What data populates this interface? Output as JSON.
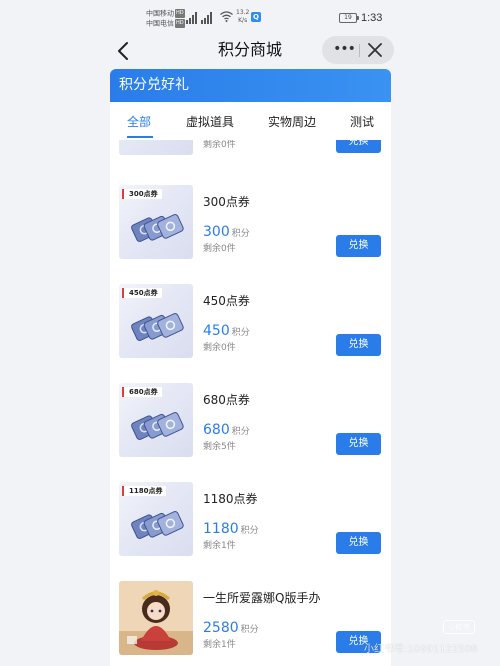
{
  "status_bar": {
    "carrier1": "中国移动",
    "carrier2": "中国电信",
    "hd": "HD",
    "net_speed_value": "13.2",
    "net_speed_unit": "K/s",
    "battery": "19",
    "time": "1:33"
  },
  "nav": {
    "title": "积分商城",
    "more_glyph": "•••"
  },
  "banner": {
    "title": "积分兑好礼"
  },
  "tabs": [
    {
      "label": "全部",
      "active": true
    },
    {
      "label": "虚拟道具",
      "active": false
    },
    {
      "label": "实物周边",
      "active": false
    },
    {
      "label": "测试",
      "active": false
    }
  ],
  "items": [
    {
      "tag": "",
      "name": "",
      "price": "",
      "unit": "",
      "stock": "剩余0件",
      "button": "兑换"
    },
    {
      "tag": "300点券",
      "name": "300点券",
      "price": "300",
      "unit": "积分",
      "stock": "剩余0件",
      "button": "兑换"
    },
    {
      "tag": "450点券",
      "name": "450点券",
      "price": "450",
      "unit": "积分",
      "stock": "剩余0件",
      "button": "兑换"
    },
    {
      "tag": "680点券",
      "name": "680点券",
      "price": "680",
      "unit": "积分",
      "stock": "剩余5件",
      "button": "兑换"
    },
    {
      "tag": "1180点券",
      "name": "1180点券",
      "price": "1180",
      "unit": "积分",
      "stock": "剩余1件",
      "button": "兑换"
    },
    {
      "tag": "",
      "name": "一生所爱露娜Q版手办",
      "price": "2580",
      "unit": "积分",
      "stock": "剩余1件",
      "button": "兑换"
    }
  ],
  "watermark": {
    "text": "小红书号:10991122508",
    "logo": "小红书"
  },
  "colors": {
    "accent": "#2a7de8",
    "tag_red": "#e23b3b"
  }
}
